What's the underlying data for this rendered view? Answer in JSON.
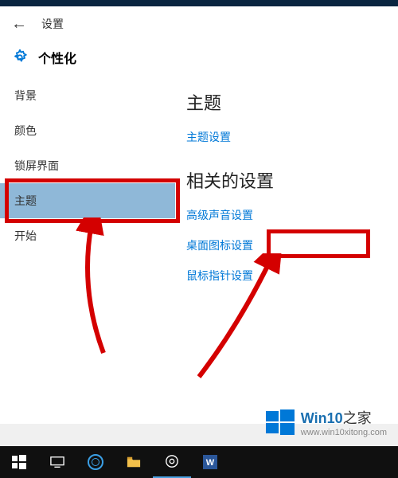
{
  "header": {
    "title": "设置",
    "category": "个性化"
  },
  "sidebar": {
    "items": [
      {
        "label": "背景"
      },
      {
        "label": "颜色"
      },
      {
        "label": "锁屏界面"
      },
      {
        "label": "主题"
      },
      {
        "label": "开始"
      }
    ],
    "selected_index": 3
  },
  "content": {
    "section1_title": "主题",
    "theme_settings_link": "主题设置",
    "section2_title": "相关的设置",
    "links": [
      {
        "label": "高级声音设置"
      },
      {
        "label": "桌面图标设置"
      },
      {
        "label": "鼠标指针设置"
      }
    ]
  },
  "watermark": {
    "brand": "Win10",
    "suffix": "之家",
    "url": "www.win10xitong.com"
  },
  "annotation": {
    "box1_target": "主题",
    "box2_target": "桌面图标设置",
    "color": "#d40000"
  }
}
